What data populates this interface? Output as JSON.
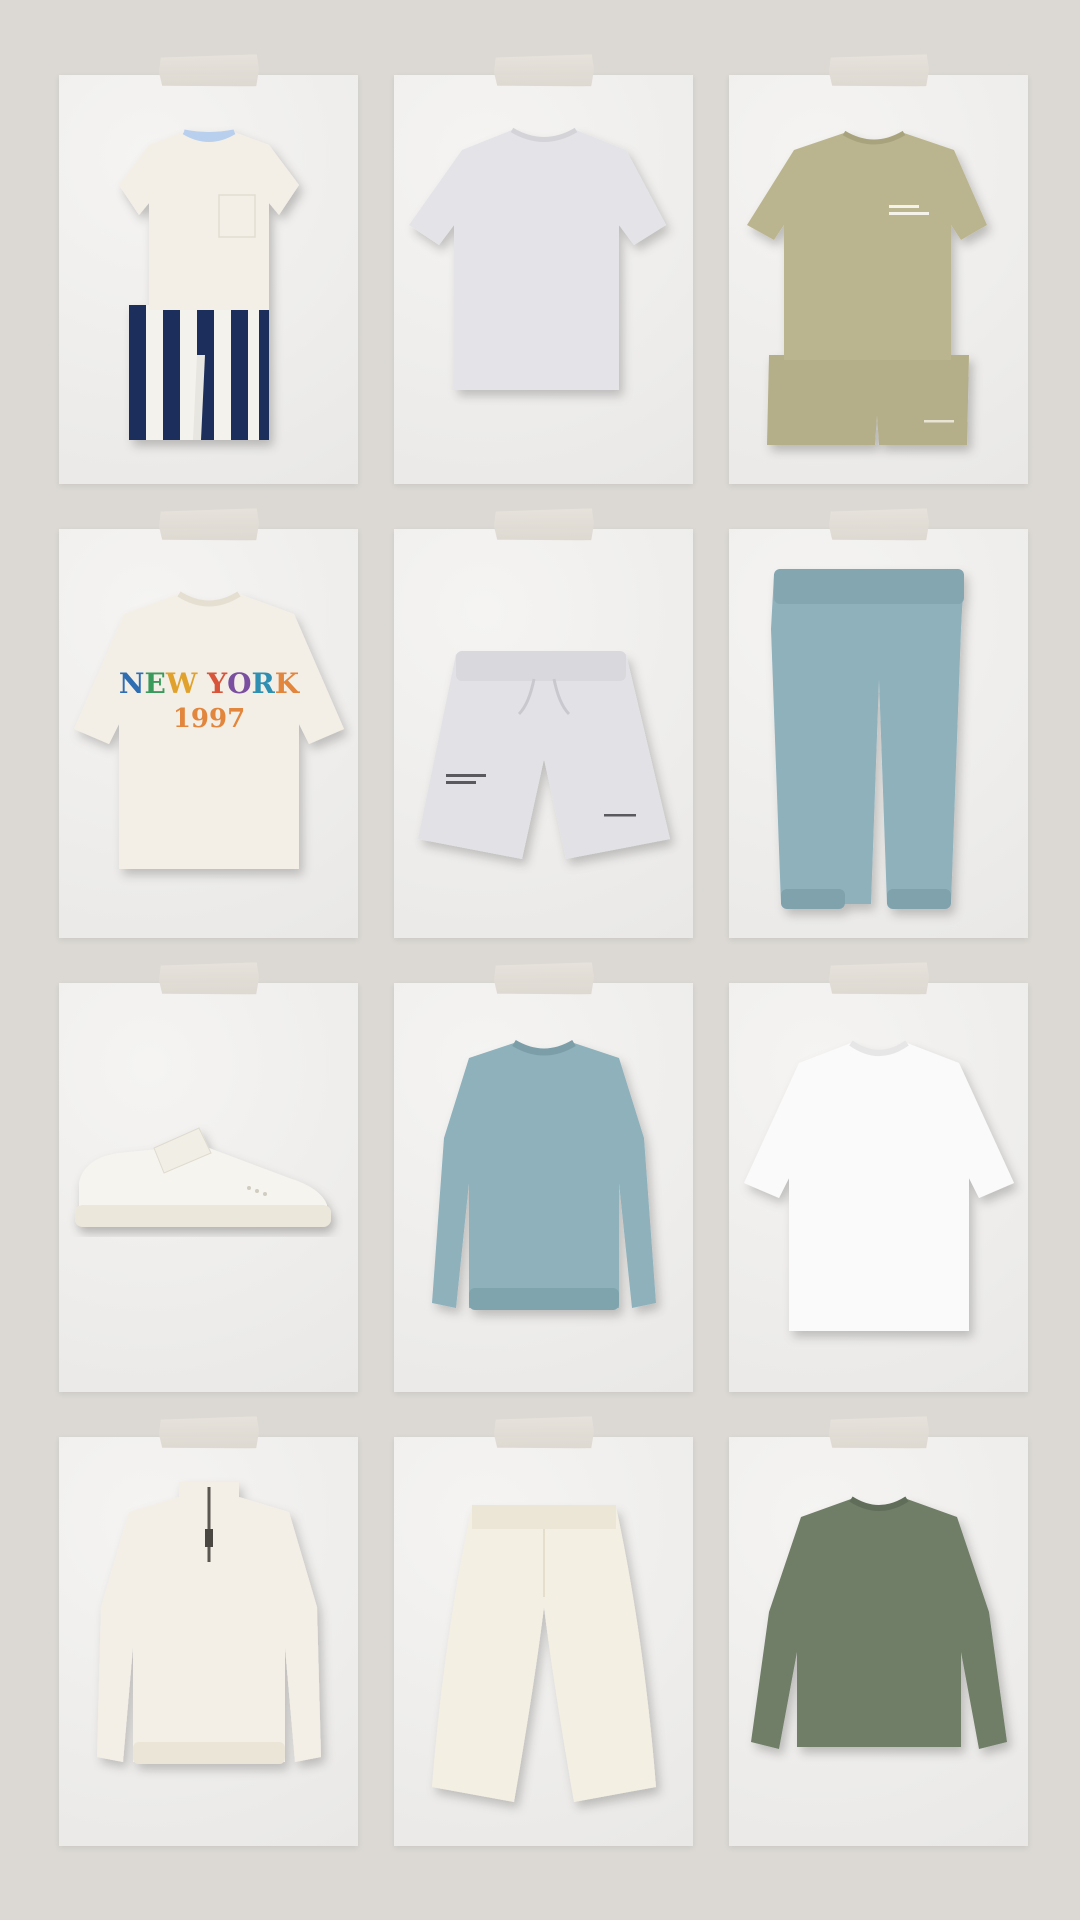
{
  "cards": [
    {
      "icon": "striped-shirt-pants-set-icon",
      "print_line1": "",
      "print_line2": ""
    },
    {
      "icon": "grey-tshirt-icon"
    },
    {
      "icon": "khaki-tee-shorts-set-icon"
    },
    {
      "icon": "new-york-tshirt-icon",
      "print_line1": "NEW YORK",
      "print_line2": "1997"
    },
    {
      "icon": "grey-shorts-icon"
    },
    {
      "icon": "blue-joggers-icon"
    },
    {
      "icon": "white-sneaker-icon"
    },
    {
      "icon": "blue-sweatshirt-icon"
    },
    {
      "icon": "white-tshirt-icon"
    },
    {
      "icon": "cream-half-zip-icon"
    },
    {
      "icon": "cream-trousers-icon"
    },
    {
      "icon": "olive-longsleeve-icon"
    }
  ],
  "colors": {
    "background": "#dcd9d4",
    "card": "#eeedeb",
    "tape": "#e2ddd5",
    "cream": "#f3efe6",
    "light_grey": "#e4e4e8",
    "khaki": "#bbb58f",
    "navy": "#1f2f5c",
    "dusty_blue": "#8eb1bc",
    "olive": "#6f7e68",
    "white": "#fafafa"
  }
}
